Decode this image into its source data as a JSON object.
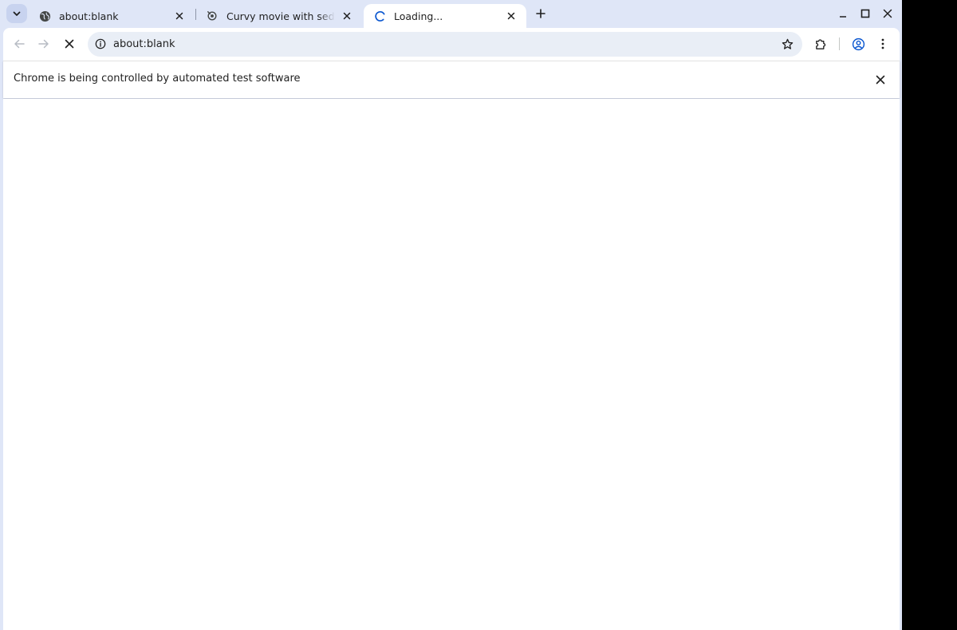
{
  "browser": {
    "tabs": [
      {
        "title": "about:blank",
        "favicon": "globe-icon",
        "active": false
      },
      {
        "title": "Curvy movie with seductive",
        "favicon": "site-favicon-icon",
        "active": false
      },
      {
        "title": "Loading...",
        "favicon": "loading-spinner-icon",
        "active": true
      }
    ],
    "address_bar": {
      "url": "about:blank"
    },
    "infobar": {
      "message": "Chrome is being controlled by automated test software"
    }
  },
  "colors": {
    "frame": "#dfe6f7",
    "omnibox": "#e9eef6",
    "accent": "#0b57d0"
  }
}
